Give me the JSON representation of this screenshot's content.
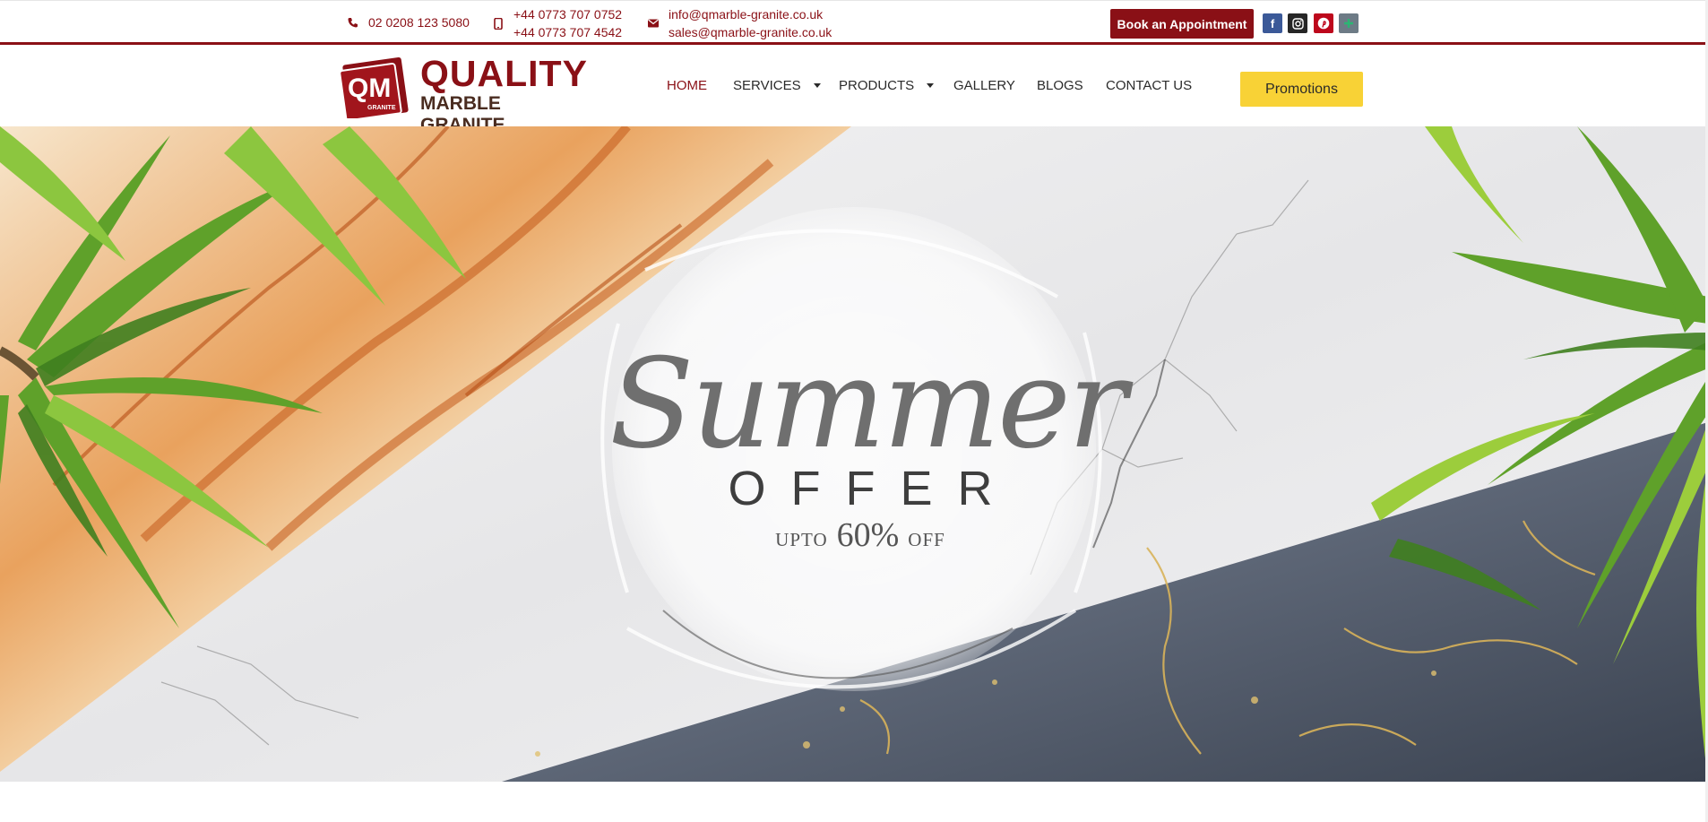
{
  "topbar": {
    "phone": "02 0208 123 5080",
    "mobiles": [
      "+44 0773 707 0752",
      "+44 0773 707 4542"
    ],
    "emails": [
      "info@qmarble-granite.co.uk",
      "sales@qmarble-granite.co.uk"
    ],
    "book_label": "Book an Appointment",
    "social": [
      {
        "name": "facebook",
        "glyph": "f",
        "color": "#3b5998"
      },
      {
        "name": "instagram",
        "glyph": "◎",
        "color": "#262626"
      },
      {
        "name": "pinterest",
        "glyph": "P",
        "color": "#bd081c"
      },
      {
        "name": "other",
        "glyph": "✦",
        "color": "#6d7b86"
      }
    ]
  },
  "logo": {
    "mark_letters": "QM",
    "mark_sub": "GRANITE",
    "line1": "QUALITY",
    "line2": "MARBLE GRANITE"
  },
  "nav": {
    "items": [
      {
        "label": "HOME",
        "active": true,
        "dropdown": false
      },
      {
        "label": "SERVICES",
        "active": false,
        "dropdown": true
      },
      {
        "label": "PRODUCTS",
        "active": false,
        "dropdown": true
      },
      {
        "label": "GALLERY",
        "active": false,
        "dropdown": false
      },
      {
        "label": "BLOGS",
        "active": false,
        "dropdown": false
      },
      {
        "label": "CONTACT US",
        "active": false,
        "dropdown": false
      }
    ],
    "promo_label": "Promotions"
  },
  "hero": {
    "title": "Summer",
    "subtitle": "OFFER",
    "upto": "UPTO",
    "discount": "60%",
    "off": "OFF"
  },
  "colors": {
    "brand": "#8a1016",
    "promo": "#f8d236",
    "text": "#2a2a2a"
  }
}
